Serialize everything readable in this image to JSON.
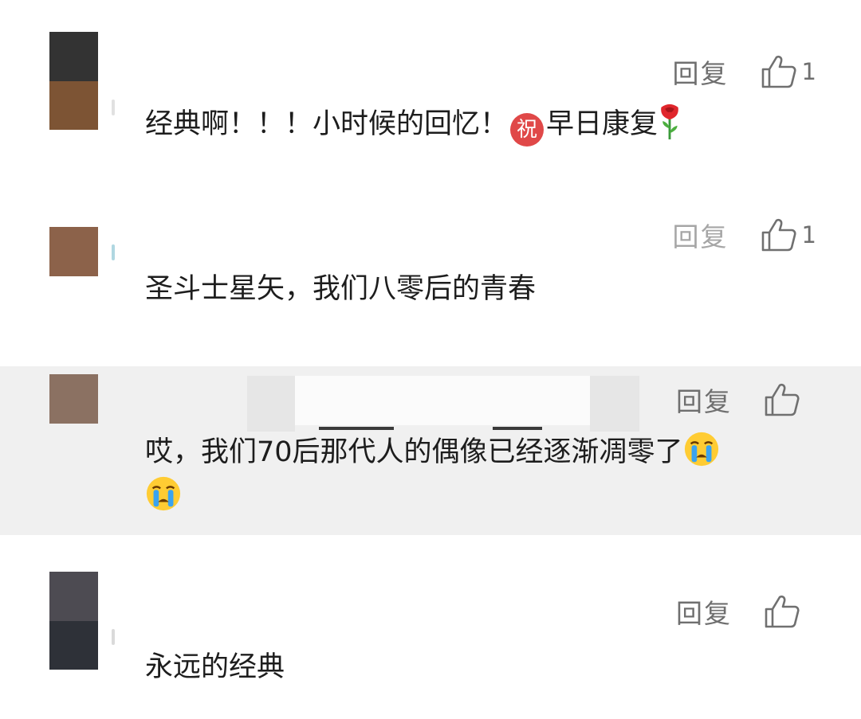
{
  "comments": [
    {
      "reply_label": "回复",
      "like_count": "1",
      "text_a": "经典啊！！！小时候的回忆！",
      "emoji_zhu": "祝",
      "text_b": "早日康复"
    },
    {
      "reply_label": "回复",
      "like_count": "1",
      "text": "圣斗士星矢，我们八零后的青春"
    },
    {
      "reply_label": "回复",
      "like_count": "",
      "text": "哎，我们70后那代人的偶像已经逐渐凋零了"
    },
    {
      "reply_label": "回复",
      "like_count": "",
      "text": "永远的经典"
    }
  ],
  "colors": {
    "highlight_bg": "#f0f0f0",
    "text": "#1d1d1d",
    "action": "#6f6f6f"
  },
  "icons": [
    "thumbs-up-icon",
    "zhu-emoji-icon",
    "rose-emoji-icon",
    "crying-emoji-icon"
  ]
}
